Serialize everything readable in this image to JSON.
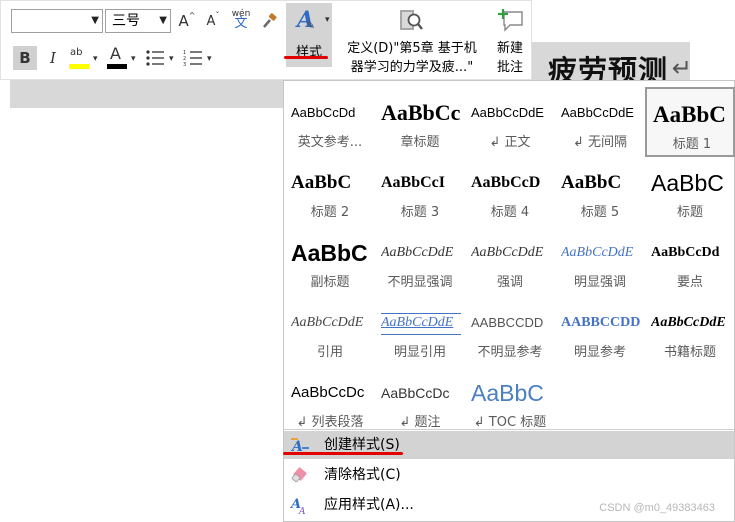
{
  "document": {
    "heading_visible": "疲劳预测",
    "return_mark": "↵"
  },
  "toolbar": {
    "font_name_value": "",
    "font_size_value": "三号",
    "grow_font_label": "A",
    "shrink_font_label": "A",
    "phonetic_top": "wén",
    "phonetic_bottom": "文",
    "bold_label": "B",
    "italic_label": "I",
    "highlight_label": "ab",
    "font_color_label": "A",
    "styles_label": "样式",
    "define_label_line1": "定义(D)\"第5章 基于机",
    "define_label_line2": "器学习的力学及疲...\"",
    "comment_label_line1": "新建",
    "comment_label_line2": "批注"
  },
  "colors": {
    "highlight": "#ffff00",
    "font_color": "#000000",
    "accent_blue": "#2e6bc7",
    "annotation_red": "#e30000"
  },
  "styles_gallery": [
    {
      "sample": "AaBbCcDd",
      "name": "英文参考...",
      "cls": "s-normal"
    },
    {
      "sample": "AaBbCcDd",
      "name": "章标题",
      "cls": "s-chapter"
    },
    {
      "sample": "AaBbCcDdE",
      "name": "↲ 正文",
      "cls": "s-normal"
    },
    {
      "sample": "AaBbCcDdE",
      "name": "↲ 无间隔",
      "cls": "s-normal"
    },
    {
      "sample": "AaBbC",
      "name": "标题 1",
      "cls": "s-h1",
      "selected": true
    },
    {
      "sample": "AaBbC",
      "name": "标题 2",
      "cls": "s-h2"
    },
    {
      "sample": "AaBbCcI",
      "name": "标题 3",
      "cls": "s-h3"
    },
    {
      "sample": "AaBbCcD",
      "name": "标题 4",
      "cls": "s-h4"
    },
    {
      "sample": "AaBbC",
      "name": "标题 5",
      "cls": "s-h5"
    },
    {
      "sample": "AaBbC",
      "name": "标题",
      "cls": "s-title"
    },
    {
      "sample": "AaBbC",
      "name": "副标题",
      "cls": "s-subtitle"
    },
    {
      "sample": "AaBbCcDdE",
      "name": "不明显强调",
      "cls": "s-italic"
    },
    {
      "sample": "AaBbCcDdE",
      "name": "强调",
      "cls": "s-italic"
    },
    {
      "sample": "AaBbCcDdE",
      "name": "明显强调",
      "cls": "s-intense-em"
    },
    {
      "sample": "AaBbCcDd",
      "name": "要点",
      "cls": "s-strong"
    },
    {
      "sample": "AaBbCcDdE",
      "name": "引用",
      "cls": "s-quote"
    },
    {
      "sample": "AaBbCcDdE",
      "name": "明显引用",
      "cls": "s-intense-quote"
    },
    {
      "sample": "AABBCCDD",
      "name": "不明显参考",
      "cls": "s-subtle-ref"
    },
    {
      "sample": "AABBCCDD",
      "name": "明显参考",
      "cls": "s-intense-ref"
    },
    {
      "sample": "AaBbCcDdE",
      "name": "书籍标题",
      "cls": "s-book"
    },
    {
      "sample": "AaBbCcDc",
      "name": "↲ 列表段落",
      "cls": "s-list"
    },
    {
      "sample": "AaBbCcDc",
      "name": "↲ 题注",
      "cls": "s-caption"
    },
    {
      "sample": "AaBbC",
      "name": "↲ TOC 标题",
      "cls": "s-toc"
    }
  ],
  "menu": {
    "create_style": "创建样式(S)",
    "clear_formatting": "清除格式(C)",
    "apply_styles": "应用样式(A)..."
  },
  "watermark": "CSDN @m0_49383463"
}
